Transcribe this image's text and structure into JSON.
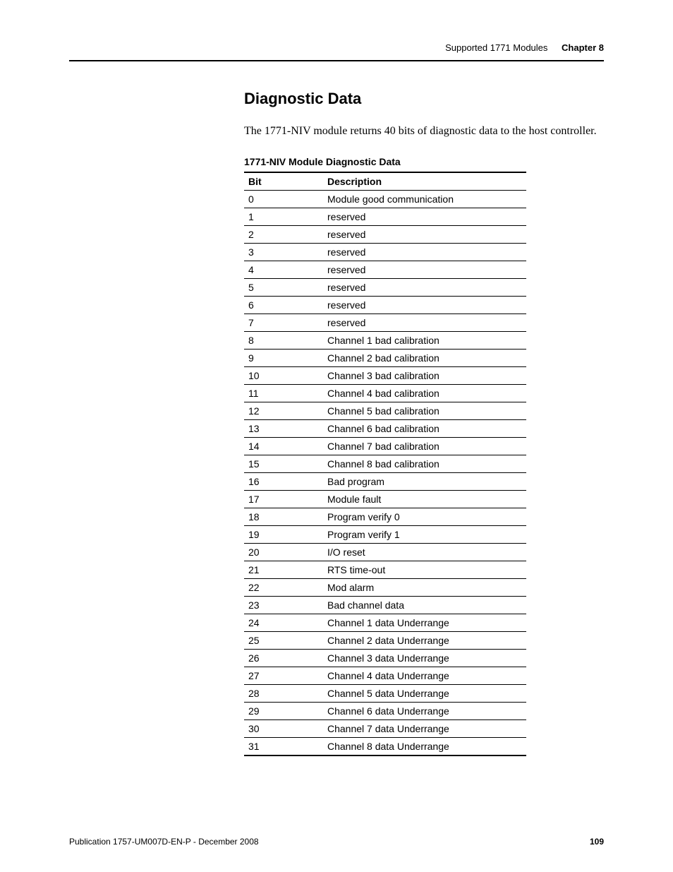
{
  "header": {
    "section": "Supported 1771 Modules",
    "chapter": "Chapter 8"
  },
  "main": {
    "heading": "Diagnostic Data",
    "paragraph": "The 1771-NIV module returns 40 bits of diagnostic data to the host controller.",
    "table_title": "1771-NIV Module Diagnostic Data",
    "columns": {
      "bit": "Bit",
      "description": "Description"
    },
    "rows": [
      {
        "bit": "0",
        "desc": "Module good communication"
      },
      {
        "bit": "1",
        "desc": "reserved"
      },
      {
        "bit": "2",
        "desc": "reserved"
      },
      {
        "bit": "3",
        "desc": "reserved"
      },
      {
        "bit": "4",
        "desc": "reserved"
      },
      {
        "bit": "5",
        "desc": "reserved"
      },
      {
        "bit": "6",
        "desc": "reserved"
      },
      {
        "bit": "7",
        "desc": "reserved"
      },
      {
        "bit": "8",
        "desc": "Channel 1 bad calibration"
      },
      {
        "bit": "9",
        "desc": "Channel 2 bad calibration"
      },
      {
        "bit": "10",
        "desc": "Channel 3 bad calibration"
      },
      {
        "bit": "11",
        "desc": "Channel 4 bad calibration"
      },
      {
        "bit": "12",
        "desc": "Channel 5 bad calibration"
      },
      {
        "bit": "13",
        "desc": "Channel 6 bad calibration"
      },
      {
        "bit": "14",
        "desc": "Channel 7 bad calibration"
      },
      {
        "bit": "15",
        "desc": "Channel 8 bad calibration"
      },
      {
        "bit": "16",
        "desc": "Bad program"
      },
      {
        "bit": "17",
        "desc": "Module fault"
      },
      {
        "bit": "18",
        "desc": "Program verify 0"
      },
      {
        "bit": "19",
        "desc": "Program verify 1"
      },
      {
        "bit": "20",
        "desc": "I/O reset"
      },
      {
        "bit": "21",
        "desc": "RTS time-out"
      },
      {
        "bit": "22",
        "desc": "Mod alarm"
      },
      {
        "bit": "23",
        "desc": "Bad channel data"
      },
      {
        "bit": "24",
        "desc": "Channel 1 data Underrange"
      },
      {
        "bit": "25",
        "desc": "Channel 2 data Underrange"
      },
      {
        "bit": "26",
        "desc": "Channel 3 data Underrange"
      },
      {
        "bit": "27",
        "desc": "Channel 4 data Underrange"
      },
      {
        "bit": "28",
        "desc": "Channel 5 data Underrange"
      },
      {
        "bit": "29",
        "desc": "Channel 6 data Underrange"
      },
      {
        "bit": "30",
        "desc": "Channel 7 data Underrange"
      },
      {
        "bit": "31",
        "desc": "Channel 8 data Underrange"
      }
    ]
  },
  "footer": {
    "publication": "Publication 1757-UM007D-EN-P - December 2008",
    "page": "109"
  }
}
